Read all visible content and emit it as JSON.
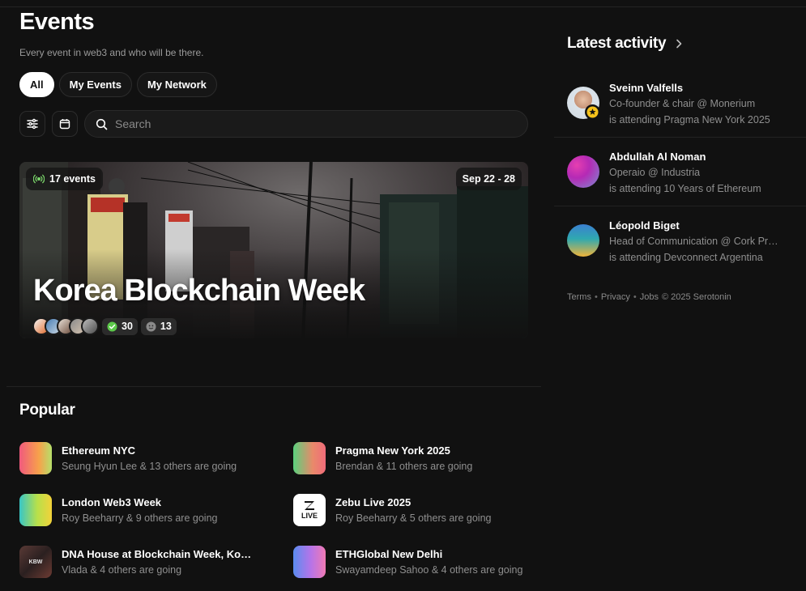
{
  "page": {
    "title": "Events",
    "subtitle": "Every event in web3 and who will be there."
  },
  "tabs": [
    {
      "label": "All",
      "active": true
    },
    {
      "label": "My Events"
    },
    {
      "label": "My Network"
    }
  ],
  "toolbar": {
    "filter_icon": "sliders-icon",
    "calendar_icon": "calendar-icon"
  },
  "search": {
    "placeholder": "Search"
  },
  "featured": {
    "title": "Korea Blockchain Week",
    "events_count": "17 events",
    "date_range": "Sep 22 - 28",
    "attending_count": "30",
    "interested_count": "13"
  },
  "popular": {
    "title": "Popular",
    "items": [
      {
        "name": "Ethereum NYC",
        "going": "Seung Hyun Lee & 13 others are going",
        "thumb": [
          "#f05a7e",
          "#f7a14b",
          "#b6e06b"
        ]
      },
      {
        "name": "Pragma New York 2025",
        "going": "Brendan & 11 others are going",
        "thumb": [
          "#5ad17d",
          "#e98a6a",
          "#f06b7a"
        ]
      },
      {
        "name": "London Web3 Week",
        "going": "Roy Beeharry & 9 others are going",
        "thumb": [
          "#38c6c6",
          "#b8e04a",
          "#f3d23a"
        ]
      },
      {
        "name": "Zebu Live 2025",
        "going": "Roy Beeharry & 5 others are going",
        "logo_text": "LIVE"
      },
      {
        "name": "DNA House at Blockchain Week, Kor...",
        "going": "Vlada & 4 others are going",
        "logo_text": "KBW"
      },
      {
        "name": "ETHGlobal New Delhi",
        "going": "Swayamdeep Sahoo & 4 others are going",
        "thumb": [
          "#5a8cf0",
          "#b774e8",
          "#f07ab4"
        ]
      }
    ]
  },
  "activity": {
    "title": "Latest activity",
    "items": [
      {
        "name": "Sveinn Valfells",
        "role": "Co-founder & chair @ Monerium",
        "attending": "is attending Pragma New York 2025"
      },
      {
        "name": "Abdullah Al Noman",
        "role": "Operaio @ Industria",
        "attending": "is attending 10 Years of Ethereum"
      },
      {
        "name": "Léopold Biget",
        "role": "Head of Communication @ Cork Proto...",
        "attending": "is attending Devconnect Argentina"
      }
    ]
  },
  "footer": {
    "terms": "Terms",
    "privacy": "Privacy",
    "jobs": "Jobs",
    "copyright": "© 2025 Serotonin"
  }
}
